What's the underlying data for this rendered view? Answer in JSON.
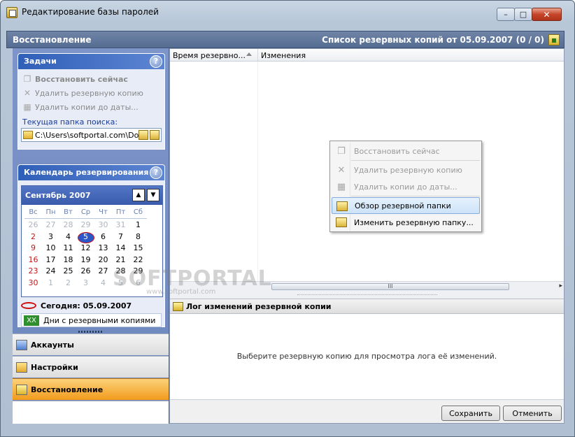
{
  "window": {
    "title": "Редактирование базы паролей",
    "min_label": "–",
    "max_label": "□",
    "close_label": "✕"
  },
  "header": {
    "section": "Восстановление",
    "list_title": "Список резервных копий от 05.09.2007 (0 / 0)"
  },
  "tasks": {
    "title": "Задачи",
    "help": "?",
    "items": [
      {
        "label": "Восстановить сейчас",
        "icon": "restore-icon"
      },
      {
        "label": "Удалить резервную копию",
        "icon": "delete-icon"
      },
      {
        "label": "Удалить копии до даты...",
        "icon": "delete-by-date-icon"
      }
    ],
    "search_folder_label": "Текущая папка поиска:",
    "search_folder_value": "C:\\Users\\softportal.com\\Doc"
  },
  "calendar": {
    "title": "Календарь резервирования",
    "help": "?",
    "month": "Сентябрь 2007",
    "prev": "▲",
    "next": "▼",
    "weekdays": [
      "Вс",
      "Пн",
      "Вт",
      "Ср",
      "Чт",
      "Пт",
      "Сб"
    ],
    "weeks": [
      [
        "26",
        "27",
        "28",
        "29",
        "30",
        "31",
        "1"
      ],
      [
        "2",
        "3",
        "4",
        "5",
        "6",
        "7",
        "8"
      ],
      [
        "9",
        "10",
        "11",
        "12",
        "13",
        "14",
        "15"
      ],
      [
        "16",
        "17",
        "18",
        "19",
        "20",
        "21",
        "22"
      ],
      [
        "23",
        "24",
        "25",
        "26",
        "27",
        "28",
        "29"
      ],
      [
        "30",
        "1",
        "2",
        "3",
        "4",
        "5",
        "6"
      ]
    ],
    "selected": "5",
    "today_label": "Сегодня: 05.09.2007",
    "legend_marker": "XX",
    "legend_text": "Дни с резервными копиями"
  },
  "nav": {
    "accounts": "Аккаунты",
    "settings": "Настройки",
    "restore": "Восстановление"
  },
  "table": {
    "col_time": "Время резервно...",
    "col_changes": "Изменения",
    "scroll_grip": "III",
    "scroll_right": "▸"
  },
  "context_menu": {
    "items": [
      {
        "label": "Восстановить сейчас",
        "enabled": false
      },
      {
        "label": "Удалить резервную копию",
        "enabled": false
      },
      {
        "label": "Удалить копии до даты...",
        "enabled": false
      },
      {
        "label": "Обзор резервной папки",
        "enabled": true
      },
      {
        "label": "Изменить резервную папку...",
        "enabled": true
      }
    ]
  },
  "log": {
    "title": "Лог изменений резервной копии",
    "message": "Выберите резервную копию для просмотра лога её изменений."
  },
  "buttons": {
    "save": "Сохранить",
    "cancel": "Отменить"
  },
  "watermark": {
    "main": "SOFTPORTAL",
    "sub": "www.softportal.com"
  }
}
